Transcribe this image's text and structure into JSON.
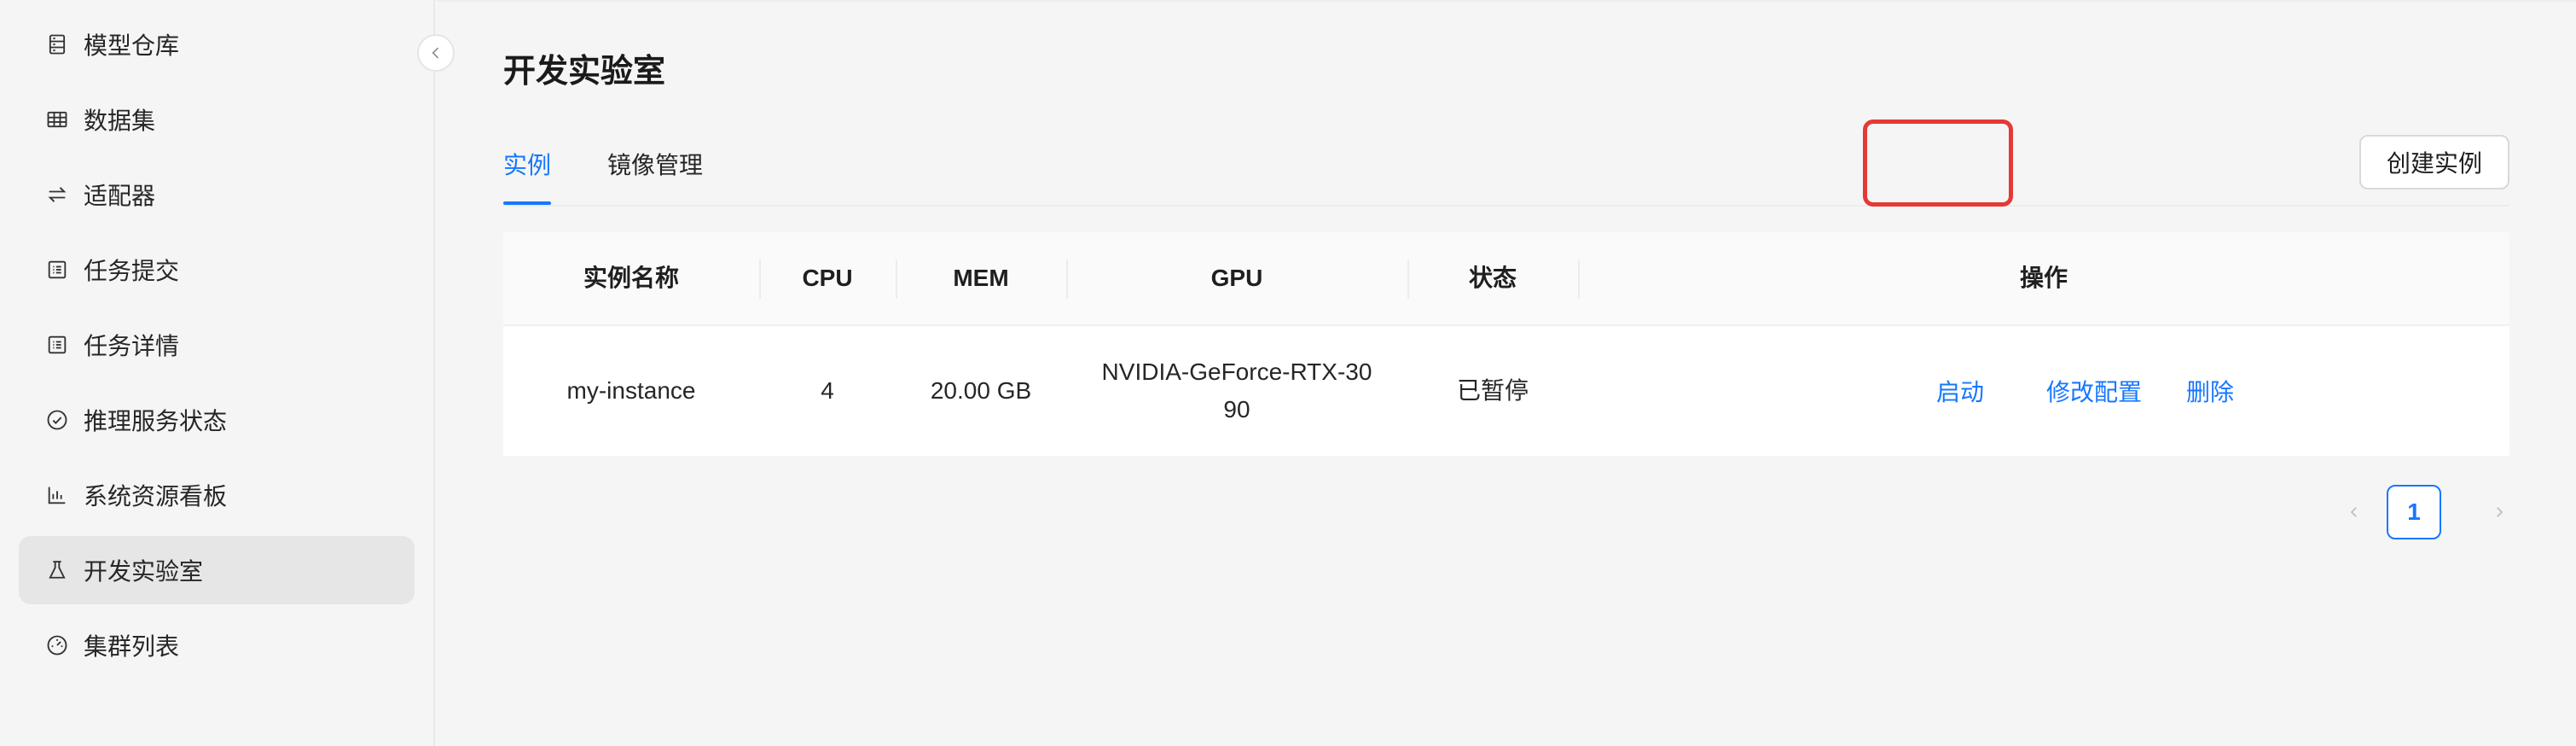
{
  "sidebar": {
    "items": [
      {
        "label": "模型仓库",
        "icon": "database-icon"
      },
      {
        "label": "数据集",
        "icon": "table-icon"
      },
      {
        "label": "适配器",
        "icon": "swap-icon"
      },
      {
        "label": "任务提交",
        "icon": "form-icon"
      },
      {
        "label": "任务详情",
        "icon": "file-list-icon"
      },
      {
        "label": "推理服务状态",
        "icon": "check-circle-icon"
      },
      {
        "label": "系统资源看板",
        "icon": "bar-chart-icon"
      },
      {
        "label": "开发实验室",
        "icon": "flask-icon",
        "active": true
      },
      {
        "label": "集群列表",
        "icon": "dashboard-icon"
      }
    ]
  },
  "page": {
    "title": "开发实验室"
  },
  "tabs": [
    {
      "label": "实例",
      "active": true
    },
    {
      "label": "镜像管理",
      "active": false
    }
  ],
  "toolbar": {
    "create_label": "创建实例"
  },
  "table": {
    "columns": [
      "实例名称",
      "CPU",
      "MEM",
      "GPU",
      "状态",
      "操作"
    ],
    "rows": [
      {
        "name": "my-instance",
        "cpu": "4",
        "mem": "20.00 GB",
        "gpu": "NVIDIA-GeForce-RTX-3090",
        "status": "已暂停",
        "actions": [
          "启动",
          "修改配置",
          "删除"
        ]
      }
    ]
  },
  "pagination": {
    "current": "1"
  },
  "colors": {
    "accent": "#1677ff",
    "highlight": "#e53935"
  }
}
